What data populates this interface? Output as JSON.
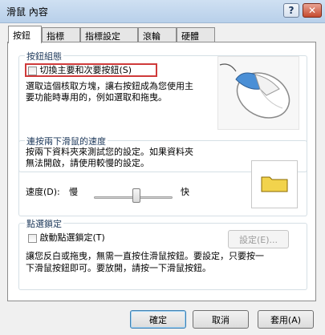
{
  "window": {
    "title": "滑鼠 內容",
    "help_glyph": "?",
    "close_glyph": "✕"
  },
  "tabs": [
    {
      "label": "按鈕",
      "active": true
    },
    {
      "label": "指標",
      "active": false
    },
    {
      "label": "指標設定",
      "active": false
    },
    {
      "label": "滾輪",
      "active": false
    },
    {
      "label": "硬體",
      "active": false
    }
  ],
  "button_config": {
    "title": "按鈕組態",
    "checkbox_label": "切換主要和次要按鈕(S)",
    "checked": false,
    "description_line1": "選取這個核取方塊，讓右按鈕成為您使用主",
    "description_line2": "要功能時專用的，例如選取和拖曳。"
  },
  "double_click": {
    "title": "連按兩下滑鼠的速度",
    "description_line1": "按兩下資料夾來測試您的設定。如果資料夾",
    "description_line2": "無法開啟，請使用較慢的設定。",
    "speed_label": "速度(D):",
    "slow_label": "慢",
    "fast_label": "快",
    "speed_level": 0.55
  },
  "click_lock": {
    "title": "點選鎖定",
    "checkbox_label": "啟動點選鎖定(T)",
    "checked": false,
    "settings_button": "設定(E)...",
    "description_line1": "讓您反白或拖曳，無需一直按住滑鼠按鈕。要設定，只要按一",
    "description_line2": "下滑鼠按鈕即可。要放開，請按一下滑鼠按鈕。"
  },
  "footer": {
    "ok": "確定",
    "cancel": "取消",
    "apply": "套用(A)"
  },
  "colors": {
    "highlight_border": "#cf3a3a",
    "mouse_button_accent": "#4a8fd6",
    "folder": "#f2d34c"
  }
}
